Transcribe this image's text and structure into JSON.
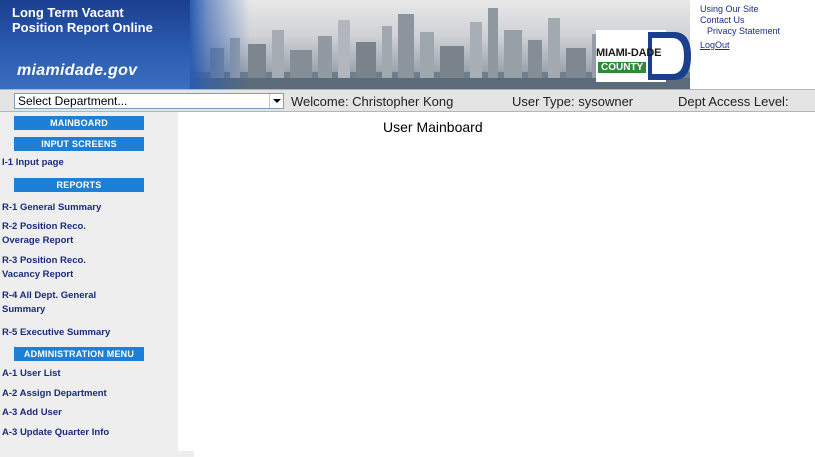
{
  "header": {
    "app_title_line1": "Long Term Vacant",
    "app_title_line2": "Position Report Online",
    "site_name": "miamidade.gov",
    "logo_line1": "MIAMI-DADE",
    "logo_line2": "COUNTY",
    "links": [
      "Using Our Site",
      "Contact Us",
      "Privacy Statement",
      "LogOut"
    ]
  },
  "info_bar": {
    "department_select_value": "Select Department...",
    "welcome": "Welcome: Christopher Kong",
    "user_type": "User Type: sysowner",
    "dept_access": "Dept Access Level:"
  },
  "sidebar": {
    "mainboard": "MAINBOARD",
    "input_screens": "INPUT SCREENS",
    "input_items": [
      "I-1 Input page"
    ],
    "reports": "REPORTS",
    "report_items": [
      "R-1 General Summary",
      "R-2 Position Reco. Overage Report",
      "R-3 Position Reco. Vacancy Report",
      "R-4 All Dept. General Summary",
      "R-5 Executive Summary"
    ],
    "admin": "ADMINISTRATION MENU",
    "admin_items": [
      "A-1 User List",
      "A-2 Assign Department",
      "A-3 Add User",
      "A-3 Update Quarter Info"
    ]
  },
  "main": {
    "title": "User Mainboard"
  },
  "colors": {
    "brand_blue": "#2a5bb0",
    "nav_header_blue": "#1e7fd6",
    "link_navy": "#1a2b7c",
    "county_green": "#2e8a3a"
  }
}
